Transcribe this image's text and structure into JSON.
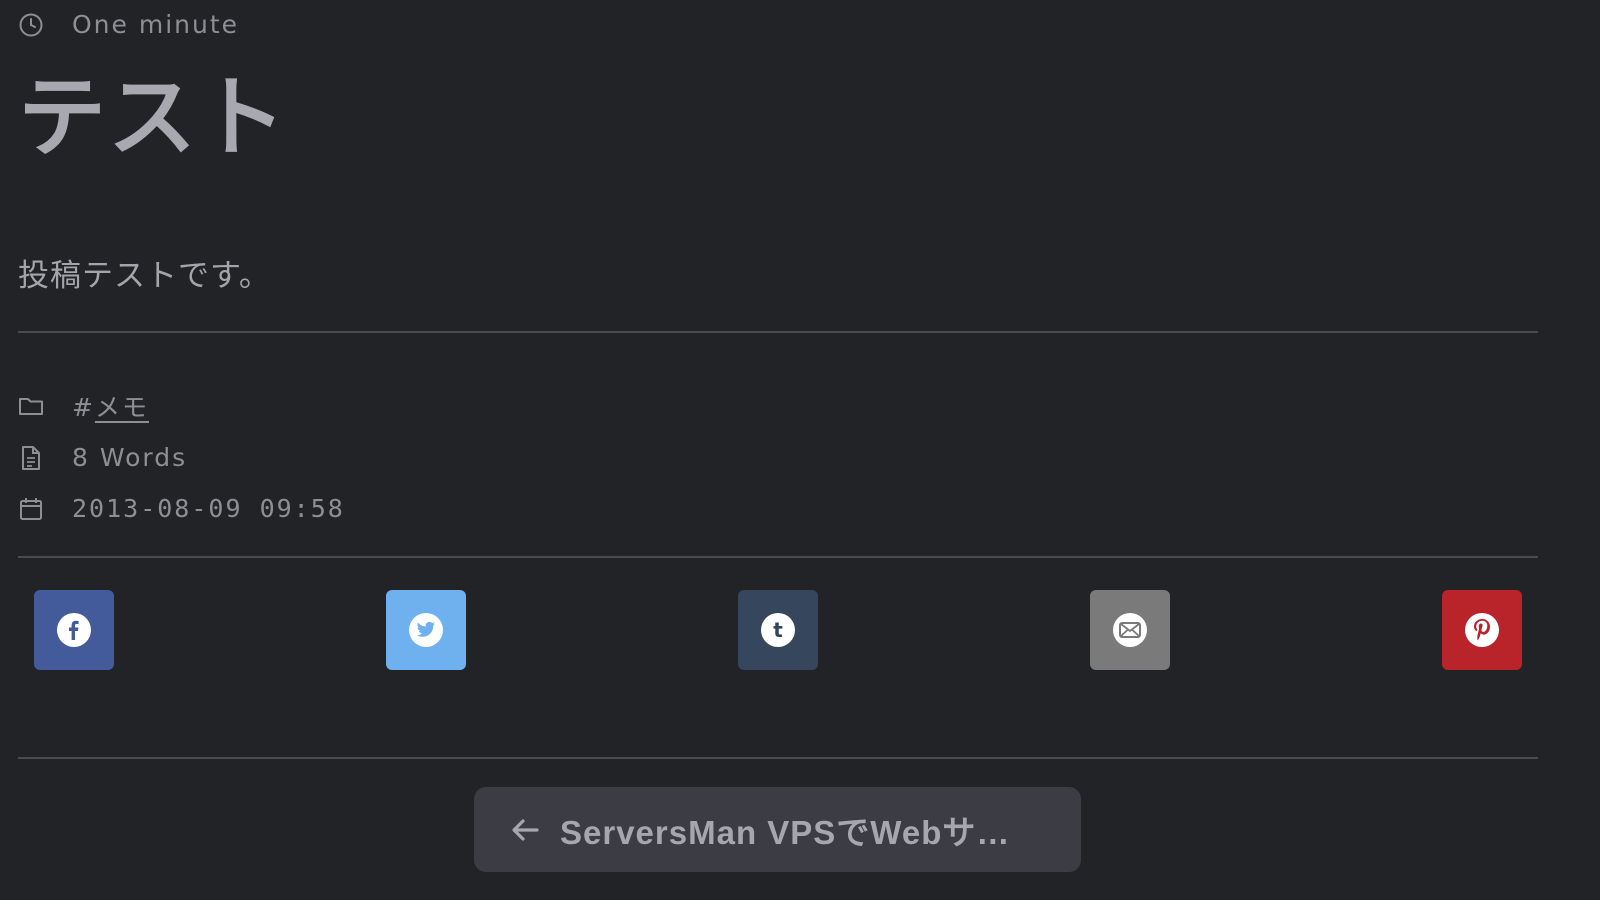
{
  "post": {
    "read_time": "One minute",
    "title": "テスト",
    "body": "投稿テストです。"
  },
  "meta": {
    "tag_hash": "#",
    "tag_label": "メモ",
    "word_count": "8 Words",
    "date": "2013-08-09 09:58"
  },
  "share": {
    "facebook_color": "#435a9b",
    "twitter_color": "#6fb0ee",
    "tumblr_color": "#36465d",
    "email_color": "#7a7a7a",
    "pinterest_color": "#b8242a"
  },
  "nav": {
    "prev_label": "ServersMan VPSでWebサ…"
  },
  "colors": {
    "background": "#222326",
    "text": "#9a9aa2",
    "divider": "#4a4b50",
    "nav_button": "#3c3d44"
  }
}
